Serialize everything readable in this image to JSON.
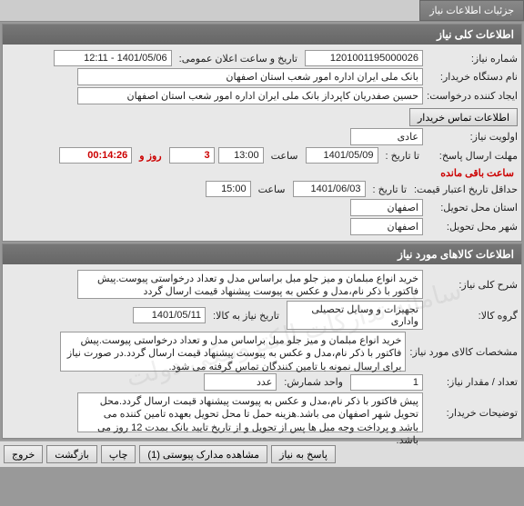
{
  "tabs": {
    "main": "جزئیات اطلاعات نیاز"
  },
  "header1": "اطلاعات کلی نیاز",
  "header2": "اطلاعات کالاهای مورد نیاز",
  "fields": {
    "reqNoLabel": "شماره نیاز:",
    "reqNo": "1201001195000026",
    "pubDateLabel": "تاریخ و ساعت اعلان عمومی:",
    "pubDate": "1401/05/06 - 12:11",
    "buyerLabel": "نام دستگاه خریدار:",
    "buyer": "بانک ملی ایران اداره امور شعب استان اصفهان",
    "creatorLabel": "ایجاد کننده درخواست:",
    "creator": "حسین صفدریان کاپرداز بانک ملی ایران اداره امور شعب استان اصفهان",
    "contactBtn": "اطلاعات تماس خریدار",
    "priorityLabel": "اولویت نیاز:",
    "priority": "عادی",
    "respDeadlineLabel": "مهلت ارسال پاسخ:",
    "toDateLabel": "تا تاریخ :",
    "respDate": "1401/05/09",
    "timeLabel": "ساعت",
    "respTime": "13:00",
    "daysRemainPre": "",
    "daysVal": "3",
    "daysRemainPost": "روز و",
    "timeRemain": "00:14:26",
    "timeRemainPost": "ساعت باقی مانده",
    "priceValidLabel": "حداقل تاریخ اعتبار قیمت:",
    "priceValidDate": "1401/06/03",
    "priceValidTime": "15:00",
    "provinceLabel": "استان محل تحویل:",
    "province": "اصفهان",
    "cityLabel": "شهر محل تحویل:",
    "city": "اصفهان"
  },
  "goods": {
    "descLabel": "شرح کلی نیاز:",
    "desc": "خرید انواع مبلمان و میز جلو مبل براساس مدل و تعداد درخواستی پیوست.پیش فاکتور با ذکر نام،مدل و عکس به پیوست پیشنهاد قیمت ارسال گردد",
    "groupLabel": "گروه کالا:",
    "group": "تجهیزات و وسایل تحصیلی واداری",
    "needDateLabel": "تاریخ نیاز به کالا:",
    "needDate": "1401/05/11",
    "specLabel": "مشخصات کالای مورد نیاز:",
    "spec": "خرید انواع مبلمان و میز جلو مبل براساس مدل و تعداد درخواستی پیوست.پیش فاکتور با ذکر نام،مدل و عکس به پیوست پیشنهاد قیمت ارسال گردد.در صورت نیاز برای ارسال نمونه با تامین کنندگان تماس گرفته می شود.",
    "qtyLabel": "تعداد / مقدار نیاز:",
    "qty": "1",
    "unitLabel": "واحد شمارش:",
    "unit": "عدد",
    "buyerNoteLabel": "توضیحات خریدار:",
    "buyerNote": "پیش فاکتور با ذکر نام،مدل و عکس به پیوست پیشنهاد قیمت ارسال گردد.محل تحویل شهر اصفهان می باشد.هزینه حمل تا محل تحویل بعهده تامین کننده می باشد و پرداخت وجه مبل ها پس از تحویل و از تاریخ تایید بانک بمدت 12 روز می باشد."
  },
  "buttons": {
    "respond": "پاسخ به نیاز",
    "attachments": "مشاهده مدارک پیوستی (1)",
    "print": "چاپ",
    "back": "بازگشت",
    "exit": "خروج"
  },
  "watermark": "سامانه تدارکات الکترونیکی دولت"
}
